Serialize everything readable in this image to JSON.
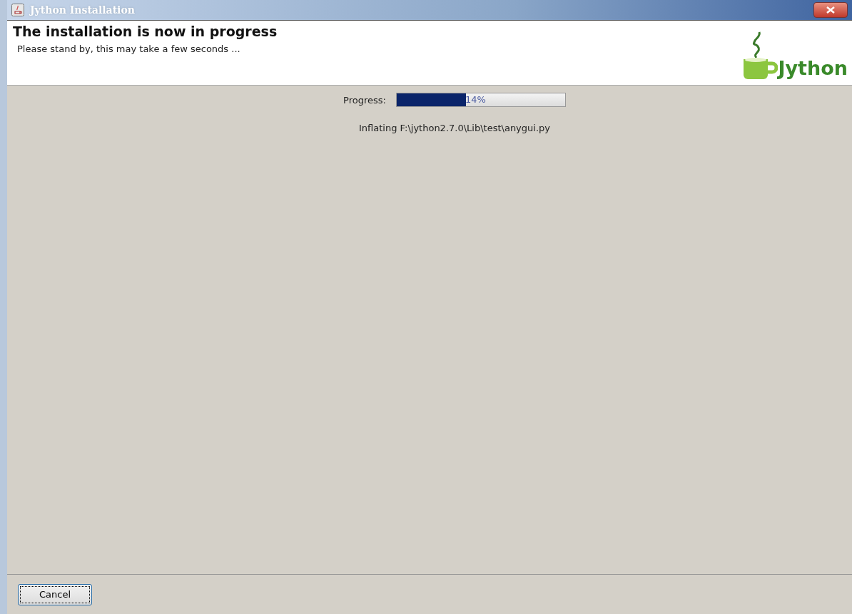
{
  "window": {
    "title": "Jython Installation"
  },
  "header": {
    "title": "The installation is now in progress",
    "subtitle": "Please stand by, this may take a few seconds ...",
    "logo_text": "Jython"
  },
  "progress": {
    "label": "Progress:",
    "level": 0.41,
    "reading": "14%"
  },
  "status": "Inflating F:\\jython2.7.0\\Lib\\test\\anygui.py",
  "buttons": [
    {
      "label": "Cancel",
      "focused": true
    }
  ]
}
